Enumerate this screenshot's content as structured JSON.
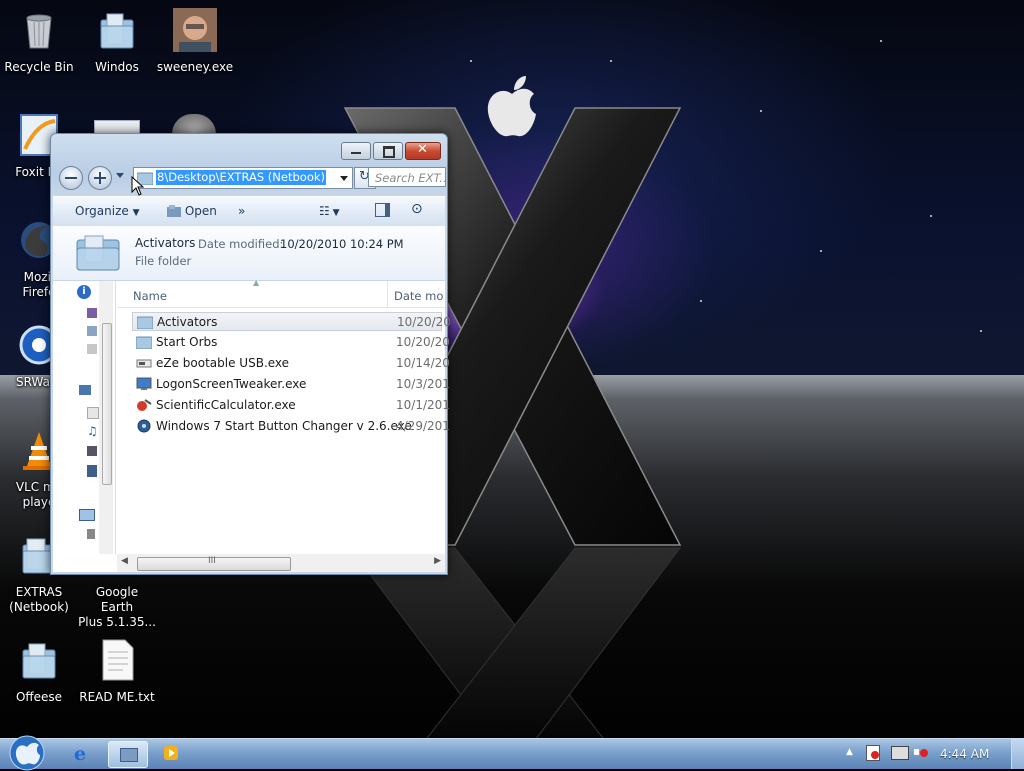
{
  "desktop": {
    "icons": {
      "recycle_bin": "Recycle Bin",
      "windos": "Windos",
      "sweeney": "sweeney.exe",
      "foxit": "Foxit Re",
      "mozilla_line1": "Mozil",
      "mozilla_line2": "Firefo",
      "srware": "SRWare",
      "vlc_line1": "VLC me",
      "vlc_line2": "playe",
      "extras_line1": "EXTRAS",
      "extras_line2": "(Netbook)",
      "google_earth_line1": "Google Earth",
      "google_earth_line2": "Plus 5.1.35...",
      "offeese": "Offeese",
      "readme": "READ ME.txt"
    }
  },
  "window": {
    "address_path": "8\\Desktop\\EXTRAS (Netbook)",
    "search_placeholder": "Search EXT...",
    "toolbar": {
      "organize": "Organize",
      "open": "Open",
      "more": "»"
    },
    "details": {
      "name": "Activators",
      "date_label": "Date modified:",
      "date_value": "10/20/2010 10:24 PM",
      "type": "File folder"
    },
    "columns": {
      "name": "Name",
      "date": "Date mo"
    },
    "files": [
      {
        "name": "Activators",
        "date": "10/20/20",
        "icon": "folder-icon"
      },
      {
        "name": "Start Orbs",
        "date": "10/20/20",
        "icon": "folder-icon"
      },
      {
        "name": "eZe bootable USB.exe",
        "date": "10/14/20",
        "icon": "usb-app-icon"
      },
      {
        "name": "LogonScreenTweaker.exe",
        "date": "10/3/201",
        "icon": "monitor-app-icon"
      },
      {
        "name": "ScientificCalculator.exe",
        "date": "10/1/201",
        "icon": "calculator-app-icon"
      },
      {
        "name": "Windows 7 Start Button Changer v 2.6.exe",
        "date": "4/29/201",
        "icon": "disc-app-icon"
      }
    ],
    "scrollbar_grip": "III"
  },
  "taskbar": {
    "clock": "4:44 AM",
    "tray_arrow": "▲"
  },
  "colors": {
    "selection": "#3399ff",
    "taskbar": "#6f96c6",
    "close_button": "#c94b33"
  }
}
